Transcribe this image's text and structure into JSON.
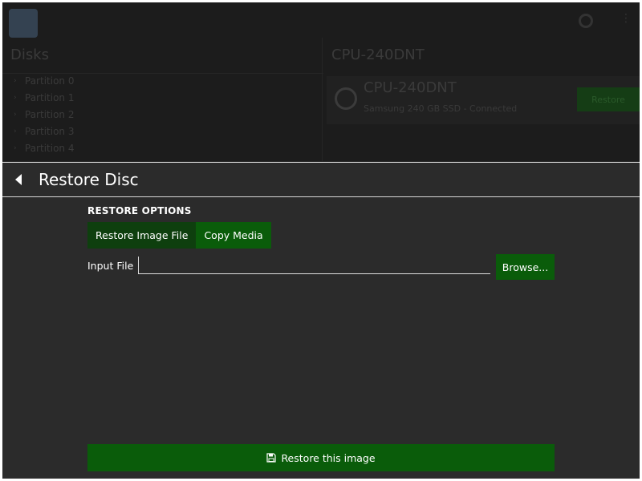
{
  "background": {
    "left_heading": "Disks",
    "partitions": [
      "Partition 0",
      "Partition 1",
      "Partition 2",
      "Partition 3",
      "Partition 4"
    ],
    "right_heading": "CPU-240DNT",
    "drive": {
      "name": "CPU-240DNT",
      "subtitle": "Samsung 240 GB SSD - Connected",
      "action_label": "Restore"
    }
  },
  "header": {
    "back_icon": "chevron-left-icon",
    "title": "Restore Disc"
  },
  "options": {
    "section_label": "RESTORE OPTIONS",
    "tabs": [
      {
        "label": "Restore Image File",
        "active": true
      },
      {
        "label": "Copy Media",
        "active": false
      }
    ]
  },
  "input": {
    "label": "Input File",
    "value": "",
    "browse_label": "Browse..."
  },
  "footer": {
    "restore_icon": "floppy-disk-icon",
    "restore_label": "Restore this image"
  },
  "colors": {
    "background": "#2b2b2b",
    "accent_green": "#0a5c0a",
    "active_tab_green": "#0e3f0e",
    "divider": "#d8d8d8"
  }
}
